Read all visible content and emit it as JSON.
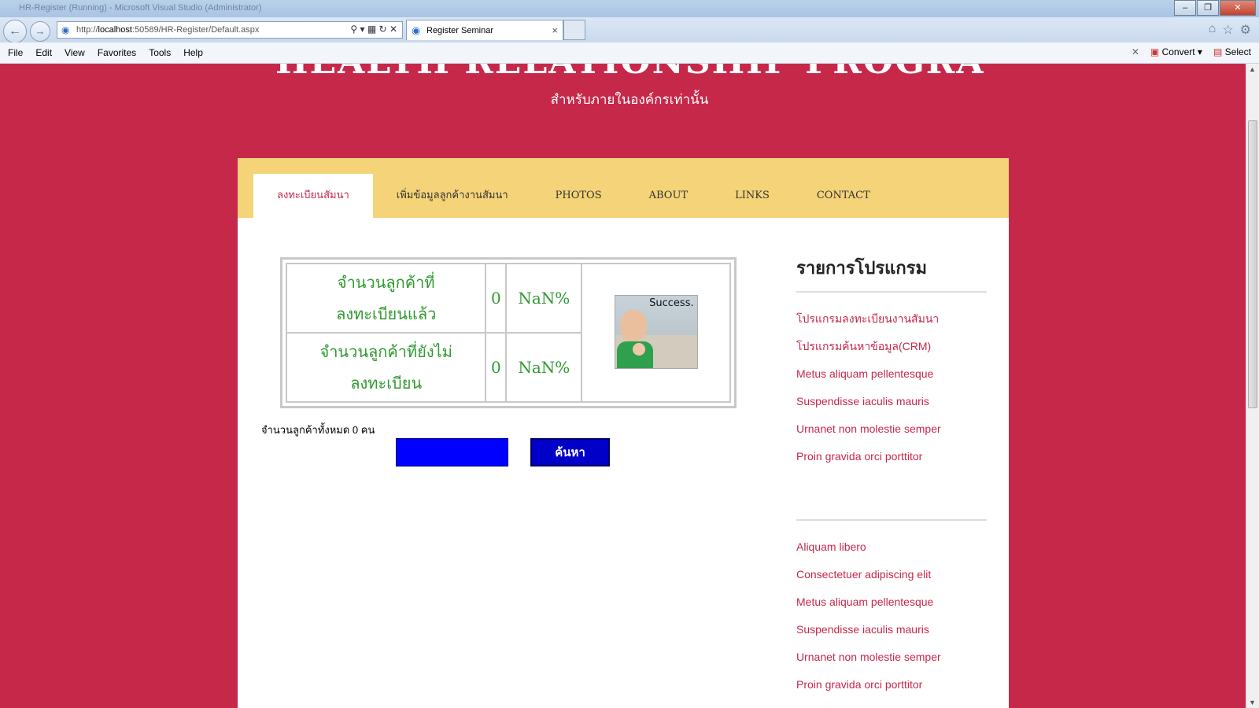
{
  "window": {
    "title": "HR-Register (Running) - Microsoft Visual Studio (Administrator)"
  },
  "browser": {
    "url_prefix": "http://",
    "url_host": "localhost",
    "url_rest": ":50589/HR-Register/Default.aspx",
    "tab_title": "Register Seminar",
    "menu": [
      "File",
      "Edit",
      "View",
      "Favorites",
      "Tools",
      "Help"
    ],
    "convert_label": "Convert",
    "select_label": "Select"
  },
  "header": {
    "big_title": "HEALTH RELATIONSHIP PROGRAM",
    "subtitle": "สำหรับภายในองค์กรเท่านั้น"
  },
  "nav": [
    "ลงทะเบียนสัมนา",
    "เพิ่มข้อมูลลูกค้างานสัมนา",
    "PHOTOS",
    "ABOUT",
    "LINKS",
    "CONTACT"
  ],
  "stats": {
    "rows": [
      {
        "label_line1": "จำนวนลูกค้าที่",
        "label_line2": "ลงทะเบียนแล้ว",
        "count": "0",
        "percent": "NaN%"
      },
      {
        "label_line1": "จำนวนลูกค้าที่ยังไม่",
        "label_line2": "ลงทะเบียน",
        "count": "0",
        "percent": "NaN%"
      }
    ],
    "image_caption": "Success."
  },
  "total_text": "จำนวนลูกค้าทั้งหมด 0 คน",
  "search_button": "ค้นหา",
  "sidebar": {
    "heading": "รายการโปรแกรม",
    "links1": [
      "โปรแกรมลงทะเบียนงานสัมนา",
      "โปรแกรมค้นหาข้อมูล(CRM)",
      "Metus aliquam pellentesque",
      "Suspendisse iaculis mauris",
      "Urnanet non molestie semper",
      "Proin gravida orci porttitor"
    ],
    "links2": [
      "Aliquam libero",
      "Consectetuer adipiscing elit",
      "Metus aliquam pellentesque",
      "Suspendisse iaculis mauris",
      "Urnanet non molestie semper",
      "Proin gravida orci porttitor"
    ]
  }
}
